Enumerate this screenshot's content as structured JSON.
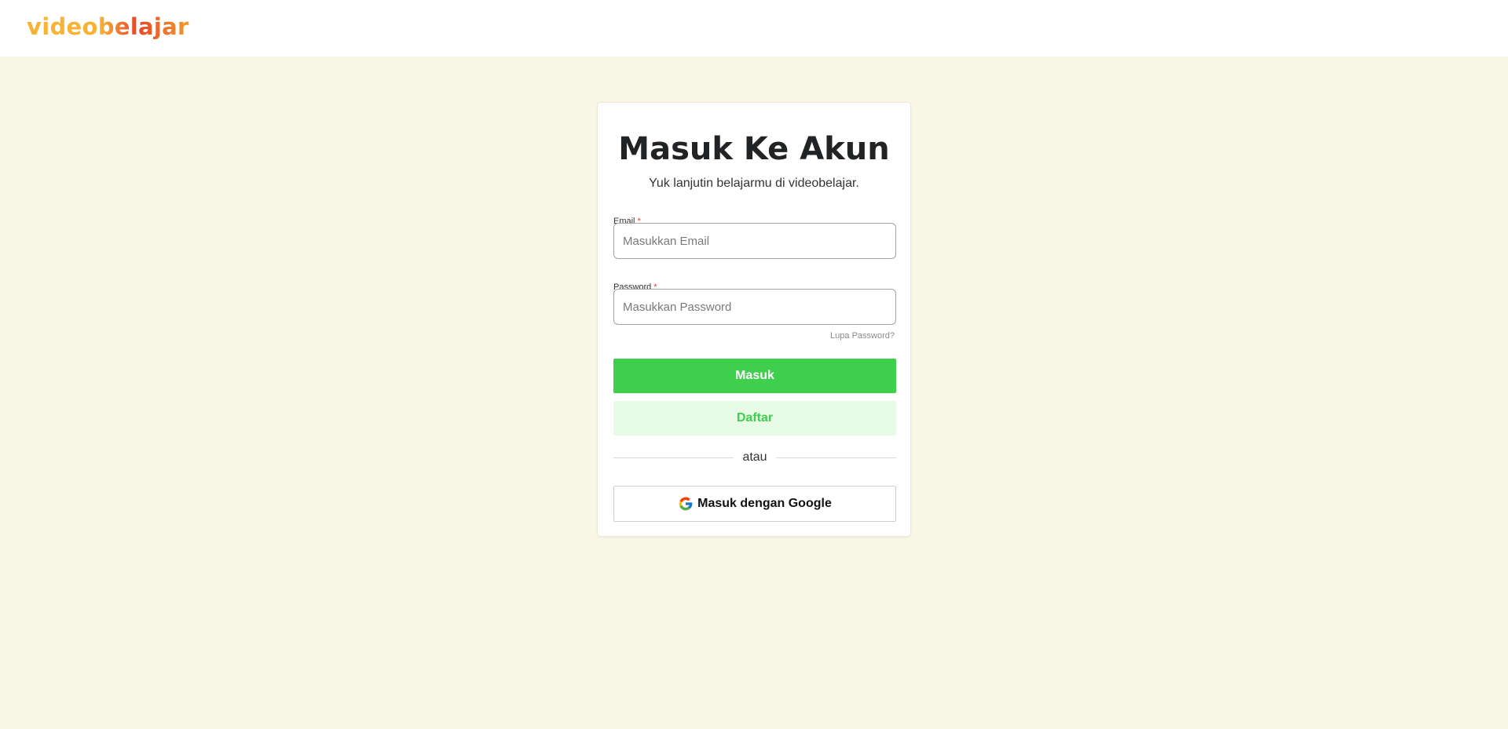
{
  "header": {
    "logo_text": "videobelajar"
  },
  "login": {
    "title": "Masuk Ke Akun",
    "subtitle": "Yuk lanjutin belajarmu di videobelajar.",
    "email": {
      "label": "Email",
      "required_mark": "*",
      "placeholder": "Masukkan Email",
      "value": ""
    },
    "password": {
      "label": "Password",
      "required_mark": "*",
      "placeholder": "Masukkan Password",
      "value": ""
    },
    "forgot_password": "Lupa Password?",
    "submit_label": "Masuk",
    "register_label": "Daftar",
    "divider_text": "atau",
    "google_label": "Masuk dengan Google",
    "google_icon": "google-icon"
  },
  "colors": {
    "page_background": "#F8F6E4",
    "primary_green": "#3ECF4C",
    "secondary_green_bg": "#E8FBE6",
    "logo_orange": "#F9B233",
    "logo_red": "#E9462A",
    "required_red": "#E53935"
  }
}
